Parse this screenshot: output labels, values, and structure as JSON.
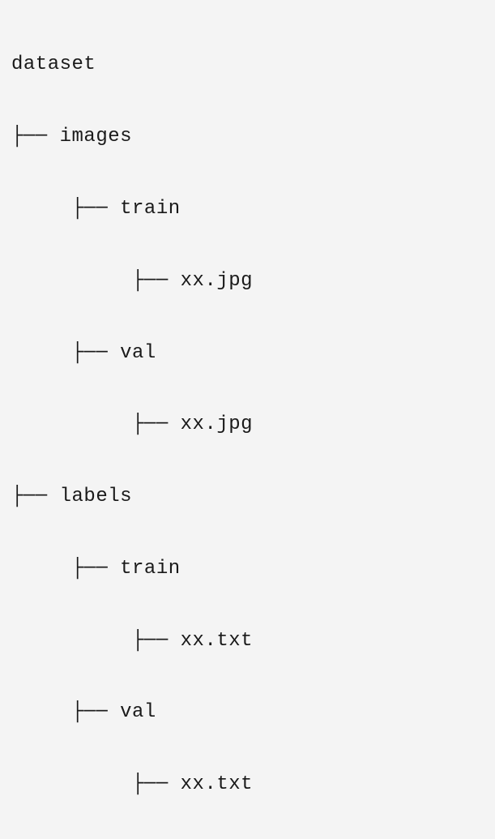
{
  "tree": {
    "root": "dataset",
    "items": [
      {
        "indent": 0,
        "name": "dataset",
        "branch": ""
      },
      {
        "indent": 1,
        "name": "images",
        "branch": "├── "
      },
      {
        "indent": 2,
        "name": "train",
        "branch": "├── "
      },
      {
        "indent": 3,
        "name": "xx.jpg",
        "branch": "├── "
      },
      {
        "indent": 2,
        "name": "val",
        "branch": "├── "
      },
      {
        "indent": 3,
        "name": "xx.jpg",
        "branch": "├── "
      },
      {
        "indent": 1,
        "name": "labels",
        "branch": "├── "
      },
      {
        "indent": 2,
        "name": "train",
        "branch": "├── "
      },
      {
        "indent": 3,
        "name": "xx.txt",
        "branch": "├── "
      },
      {
        "indent": 2,
        "name": "val",
        "branch": "├── "
      },
      {
        "indent": 3,
        "name": "xx.txt",
        "branch": "├── "
      }
    ]
  }
}
